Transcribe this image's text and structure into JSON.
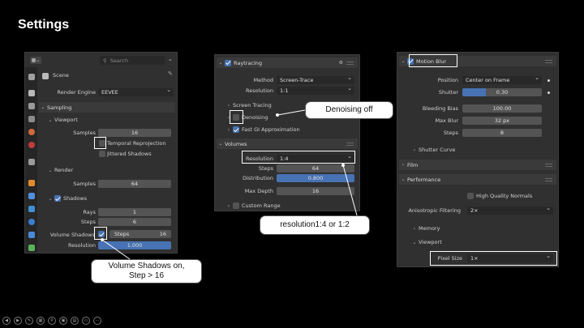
{
  "page_title": "Settings",
  "left": {
    "search_placeholder": "Search",
    "scene": "Scene",
    "render_engine_label": "Render Engine",
    "render_engine": "EEVEE",
    "sampling": "Sampling",
    "viewport": "Viewport",
    "samples_label": "Samples",
    "viewport_samples": "16",
    "temporal_reprojection": "Temporal Reprojection",
    "jittered_shadows": "Jittered Shadows",
    "render": "Render",
    "render_samples": "64",
    "shadows": "Shadows",
    "rays_label": "Rays",
    "rays": "1",
    "steps_label": "Steps",
    "steps": "6",
    "volume_shadows_label": "Volume Shadows",
    "vs_steps_label": "Steps",
    "vs_steps": "16",
    "resolution_label": "Resolution",
    "resolution": "1.000"
  },
  "mid": {
    "raytracing": "Raytracing",
    "method_label": "Method",
    "method": "Screen-Trace",
    "resolution_label": "Resolution",
    "resolution": "1:1",
    "screen_tracing": "Screen Tracing",
    "denoising": "Denoising",
    "fast_gi": "Fast GI Approximation",
    "volumes": "Volumes",
    "vol_resolution": "1:4",
    "steps_label": "Steps",
    "steps": "64",
    "distribution_label": "Distribution",
    "distribution": "0.800",
    "max_depth_label": "Max Depth",
    "max_depth": "16",
    "custom_range": "Custom Range"
  },
  "right": {
    "motion_blur": "Motion Blur",
    "position_label": "Position",
    "position": "Center on Frame",
    "shutter_label": "Shutter",
    "shutter": "0.30",
    "shutter_fraction": 0.3,
    "bleeding_bias_label": "Bleeding Bias",
    "bleeding_bias": "100.00",
    "max_blur_label": "Max Blur",
    "max_blur": "32 px",
    "steps_label": "Steps",
    "steps": "8",
    "shutter_curve": "Shutter Curve",
    "film": "Film",
    "performance": "Performance",
    "high_quality_normals": "High Quality Normals",
    "aniso_label": "Anisotropic Filtering",
    "aniso": "2×",
    "memory": "Memory",
    "viewport": "Viewport",
    "pixel_size_label": "Pixel Size",
    "pixel_size": "1×"
  },
  "callouts": {
    "denoising": "Denoising off",
    "resolution": "resolution1:4 or 1:2",
    "volume_shadows_line1": "Volume Shadows on,",
    "volume_shadows_line2": "Step > 16"
  },
  "colors": {
    "accent": "#4772b3",
    "panel": "#303030",
    "field": "#545454",
    "highlight": "#ffffff"
  }
}
